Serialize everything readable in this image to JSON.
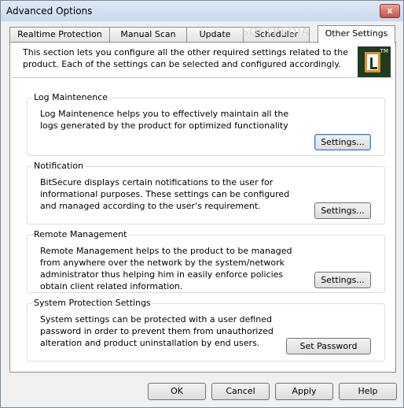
{
  "window": {
    "title": "Advanced Options",
    "close_label": "x"
  },
  "tabs": [
    {
      "label": "Realtime Protection"
    },
    {
      "label": "Manual Scan"
    },
    {
      "label": "Update"
    },
    {
      "label": "Scheduler"
    },
    {
      "label": "Other Settings",
      "active": true
    }
  ],
  "intro": "This section lets you configure all the other required settings related to the product. Each of the settings can be selected and configured accordingly.",
  "logo": {
    "tm": "TM"
  },
  "groups": {
    "log": {
      "title": "Log Maintenence",
      "text": "Log Maintenence helps you to effectively maintain all the logs generated by the product for optimized functionality",
      "button": "Settings..."
    },
    "notification": {
      "title": "Notification",
      "text": "BitSecure displays certain notifications to the user for informational purposes.  These settings can be configured and managed  according to the user's requirement.",
      "button": "Settings..."
    },
    "remote": {
      "title": "Remote Management",
      "text": "Remote Management helps to the product to be managed from anywhere over the network by the system/network administrator thus helping him in easily enforce policies obtain client related information.",
      "button": "Settings..."
    },
    "system": {
      "title": "System Protection Settings",
      "text": "System settings can be protected with a user defined password in order to prevent them from unauthorized alteration and product uninstallation by end users.",
      "button": "Set Password"
    }
  },
  "footer": {
    "ok": "OK",
    "cancel": "Cancel",
    "apply": "Apply",
    "help": "Help"
  },
  "watermark": "SOFTPEDIA"
}
